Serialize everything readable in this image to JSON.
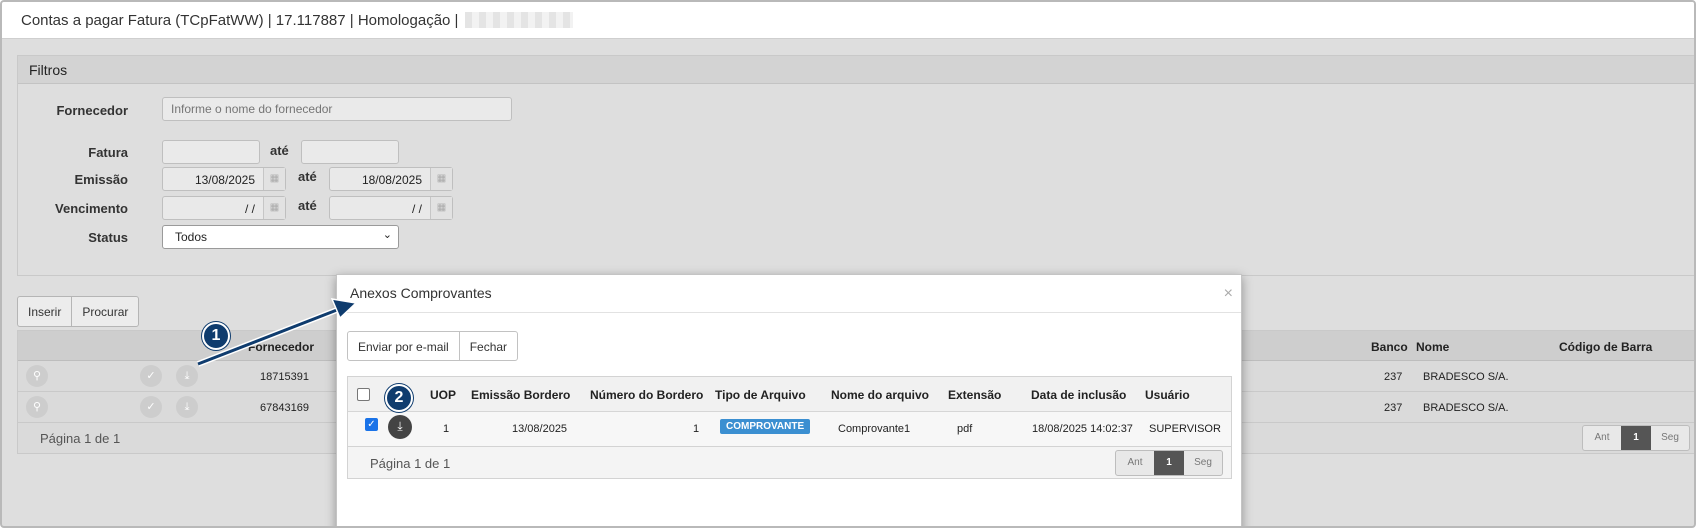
{
  "title": {
    "text": "Contas a pagar Fatura (TCpFatWW) | 17.117887 | Homologação |"
  },
  "filters": {
    "heading": "Filtros",
    "fornecedor": {
      "label": "Fornecedor",
      "placeholder": "Informe o nome do fornecedor"
    },
    "fatura": {
      "label": "Fatura",
      "from": "",
      "to": ""
    },
    "emissao": {
      "label": "Emissão",
      "from": "13/08/2025",
      "to": "18/08/2025"
    },
    "vencimento": {
      "label": "Vencimento",
      "from": "/ /",
      "to": "/ /"
    },
    "status": {
      "label": "Status",
      "value": "Todos"
    },
    "ate": "até"
  },
  "actions": {
    "inserir": "Inserir",
    "procurar": "Procurar"
  },
  "grid": {
    "headers": {
      "fornecedor": "Fornecedor",
      "banco": "Banco",
      "nome": "Nome",
      "codigo": "Código de Barra"
    },
    "rows": [
      {
        "fornecedor": "18715391",
        "partial": "O",
        "banco": "237",
        "nome": "BRADESCO S/A."
      },
      {
        "fornecedor": "67843169",
        "partial": "O",
        "banco": "237",
        "nome": "BRADESCO S/A."
      }
    ],
    "footer": "Página 1 de 1",
    "pager": {
      "prev": "Ant",
      "current": "1",
      "next": "Seg"
    }
  },
  "modal": {
    "title": "Anexos Comprovantes",
    "close": "×",
    "buttons": {
      "email": "Enviar por e-mail",
      "close": "Fechar"
    },
    "headers": {
      "uop": "UOP",
      "emissao": "Emissão Bordero",
      "numero": "Número do Bordero",
      "tipo": "Tipo de Arquivo",
      "nome": "Nome do arquivo",
      "ext": "Extensão",
      "data": "Data de inclusão",
      "usuario": "Usuário"
    },
    "row": {
      "checked": true,
      "uop": "1",
      "emissao": "13/08/2025",
      "numero": "1",
      "tipo": "COMPROVANTE",
      "nome": "Comprovante1",
      "ext": "pdf",
      "data": "18/08/2025 14:02:37",
      "usuario": "SUPERVISOR"
    },
    "footer": "Página 1 de 1",
    "pager": {
      "prev": "Ant",
      "current": "1",
      "next": "Seg"
    }
  },
  "callouts": {
    "one": "1",
    "two": "2"
  },
  "icons": {
    "search": "search-icon",
    "check": "check-icon",
    "download": "download-icon",
    "calendar": "calendar-icon",
    "dropdown": "chevron-down-icon"
  }
}
